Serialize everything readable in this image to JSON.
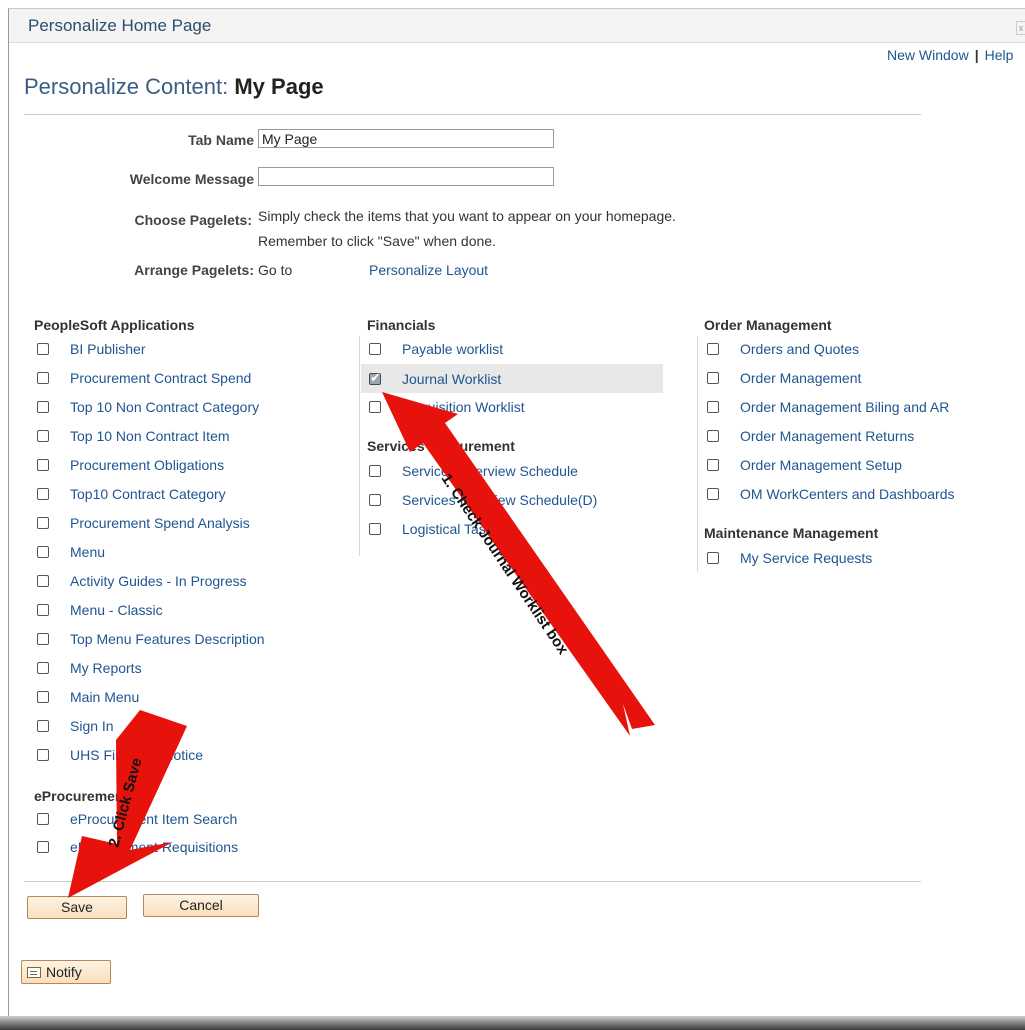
{
  "window": {
    "title": "Personalize Home Page",
    "close": "x"
  },
  "top_links": {
    "new_window": "New Window",
    "separator": "|",
    "help": "Help"
  },
  "heading": {
    "prefix": "Personalize Content:",
    "name": "My Page"
  },
  "form": {
    "tab_name_label": "Tab Name",
    "tab_name_value": "My Page",
    "welcome_label": "Welcome Message",
    "welcome_value": "",
    "choose_label": "Choose Pagelets:",
    "choose_text_1": "Simply check the items that you want to appear on your homepage.",
    "choose_text_2": "Remember to click \"Save\" when done.",
    "arrange_label": "Arrange Pagelets:",
    "arrange_goto": "Go to",
    "arrange_link": "Personalize Layout"
  },
  "groups": {
    "peoplesoft": {
      "title": "PeopleSoft Applications",
      "items": [
        {
          "label": "BI Publisher",
          "checked": false
        },
        {
          "label": "Procurement Contract Spend",
          "checked": false
        },
        {
          "label": "Top 10 Non Contract Category",
          "checked": false
        },
        {
          "label": "Top 10 Non Contract Item",
          "checked": false
        },
        {
          "label": "Procurement Obligations",
          "checked": false
        },
        {
          "label": "Top10 Contract Category",
          "checked": false
        },
        {
          "label": "Procurement Spend Analysis",
          "checked": false
        },
        {
          "label": "Menu",
          "checked": false
        },
        {
          "label": "Activity Guides - In Progress",
          "checked": false
        },
        {
          "label": "Menu - Classic",
          "checked": false
        },
        {
          "label": "Top Menu Features Description",
          "checked": false
        },
        {
          "label": "My Reports",
          "checked": false
        },
        {
          "label": "Main Menu",
          "checked": false
        },
        {
          "label": "Sign In",
          "checked": false
        },
        {
          "label": "UHS Financial Notice",
          "checked": false
        }
      ]
    },
    "eprocurement": {
      "title": "eProcurement",
      "items": [
        {
          "label": "eProcurement Item Search",
          "checked": false
        },
        {
          "label": "eProcurement Requisitions",
          "checked": false
        }
      ]
    },
    "financials": {
      "title": "Financials",
      "items": [
        {
          "label": "Payable worklist",
          "checked": false
        },
        {
          "label": "Journal Worklist",
          "checked": true
        },
        {
          "label": "Requisition Worklist",
          "checked": false
        }
      ]
    },
    "services": {
      "title": "Services Procurement",
      "items": [
        {
          "label": "Services Interview Schedule",
          "checked": false
        },
        {
          "label": "Services Interview Schedule(D)",
          "checked": false
        },
        {
          "label": "Logistical Tasks",
          "checked": false
        }
      ]
    },
    "order": {
      "title": "Order Management",
      "items": [
        {
          "label": "Orders and Quotes",
          "checked": false
        },
        {
          "label": "Order Management",
          "checked": false
        },
        {
          "label": "Order Management Biling and AR",
          "checked": false
        },
        {
          "label": "Order Management Returns",
          "checked": false
        },
        {
          "label": "Order Management Setup",
          "checked": false
        },
        {
          "label": "OM WorkCenters and Dashboards",
          "checked": false
        }
      ]
    },
    "maintenance": {
      "title": "Maintenance Management",
      "items": [
        {
          "label": "My Service Requests",
          "checked": false
        }
      ]
    }
  },
  "buttons": {
    "save": "Save",
    "cancel": "Cancel",
    "notify": "Notify"
  },
  "annotations": {
    "step1": "1. Check Journal Worklist box",
    "step2": "2. Click Save",
    "arrow_color": "#e8120c"
  }
}
